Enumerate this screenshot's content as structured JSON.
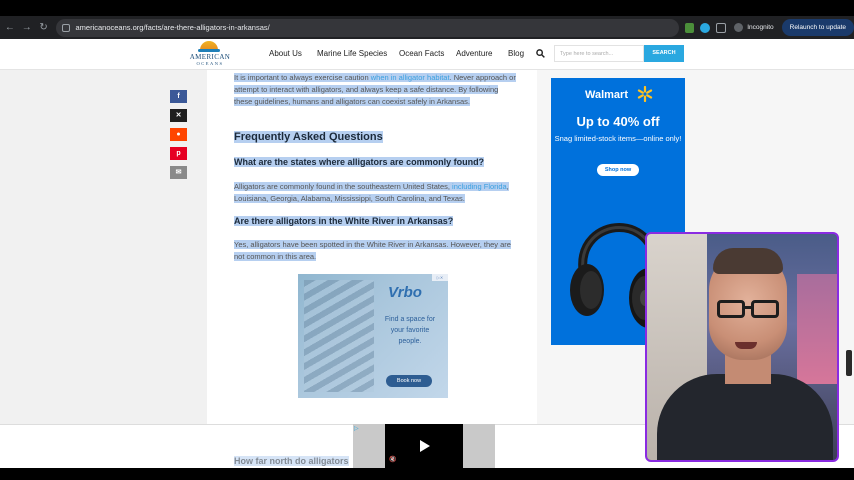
{
  "browser": {
    "url": "americanoceans.org/facts/are-there-alligators-in-arkansas/",
    "incognito_label": "Incognito",
    "relaunch_label": "Relaunch to update"
  },
  "site": {
    "logo_line1": "AMERICAN",
    "logo_line2": "OCEANS",
    "nav": [
      "About Us",
      "Marine Life Species",
      "Ocean Facts",
      "Adventure",
      "Blog"
    ],
    "search_placeholder": "Type here to search...",
    "search_button": "SEARCH"
  },
  "share": {
    "icons": [
      "facebook-icon",
      "x-icon",
      "reddit-icon",
      "pinterest-icon",
      "email-icon"
    ],
    "colors": [
      "#3b5998",
      "#1f1f1f",
      "#ff4500",
      "#e60023",
      "#8a8a8a"
    ]
  },
  "article": {
    "para1_a": "It is important to always exercise caution ",
    "para1_link": "when in alligator habitat",
    "para1_b": ". Never approach or attempt to interact with alligators, and always keep a safe distance. By following these guidelines, humans and alligators can coexist safely in Arkansas.",
    "faq_heading": "Frequently Asked Questions",
    "q1": "What are the states where alligators are commonly found?",
    "a1_a": "Alligators are commonly found in the southeastern United States, ",
    "a1_link": "including Florida",
    "a1_b": ", Louisiana, Georgia, Alabama, Mississippi, South Carolina, and Texas.",
    "q2": "Are there alligators in the White River in Arkansas?",
    "a2": "Yes, alligators have been spotted in the White River in Arkansas. However, they are not common in this area.",
    "q3_partial": "How far north do alligators"
  },
  "ads": {
    "vrbo_logo": "Vrbo",
    "vrbo_text": "Find a space for your favorite people.",
    "vrbo_button": "Book now",
    "walmart_brand": "Walmart",
    "walmart_offer": "Up to 40% off",
    "walmart_sub": "Snag limited-stock items—online only!",
    "walmart_button": "Shop now",
    "colors": {
      "walmart_blue": "#0071dc",
      "walmart_spark": "#ffc220",
      "vrbo_blue": "#2f6fb0"
    }
  },
  "theme": {
    "accent": "#2aa8e0",
    "selection": "#b6cff0",
    "cam_border": "#8a2be2"
  }
}
